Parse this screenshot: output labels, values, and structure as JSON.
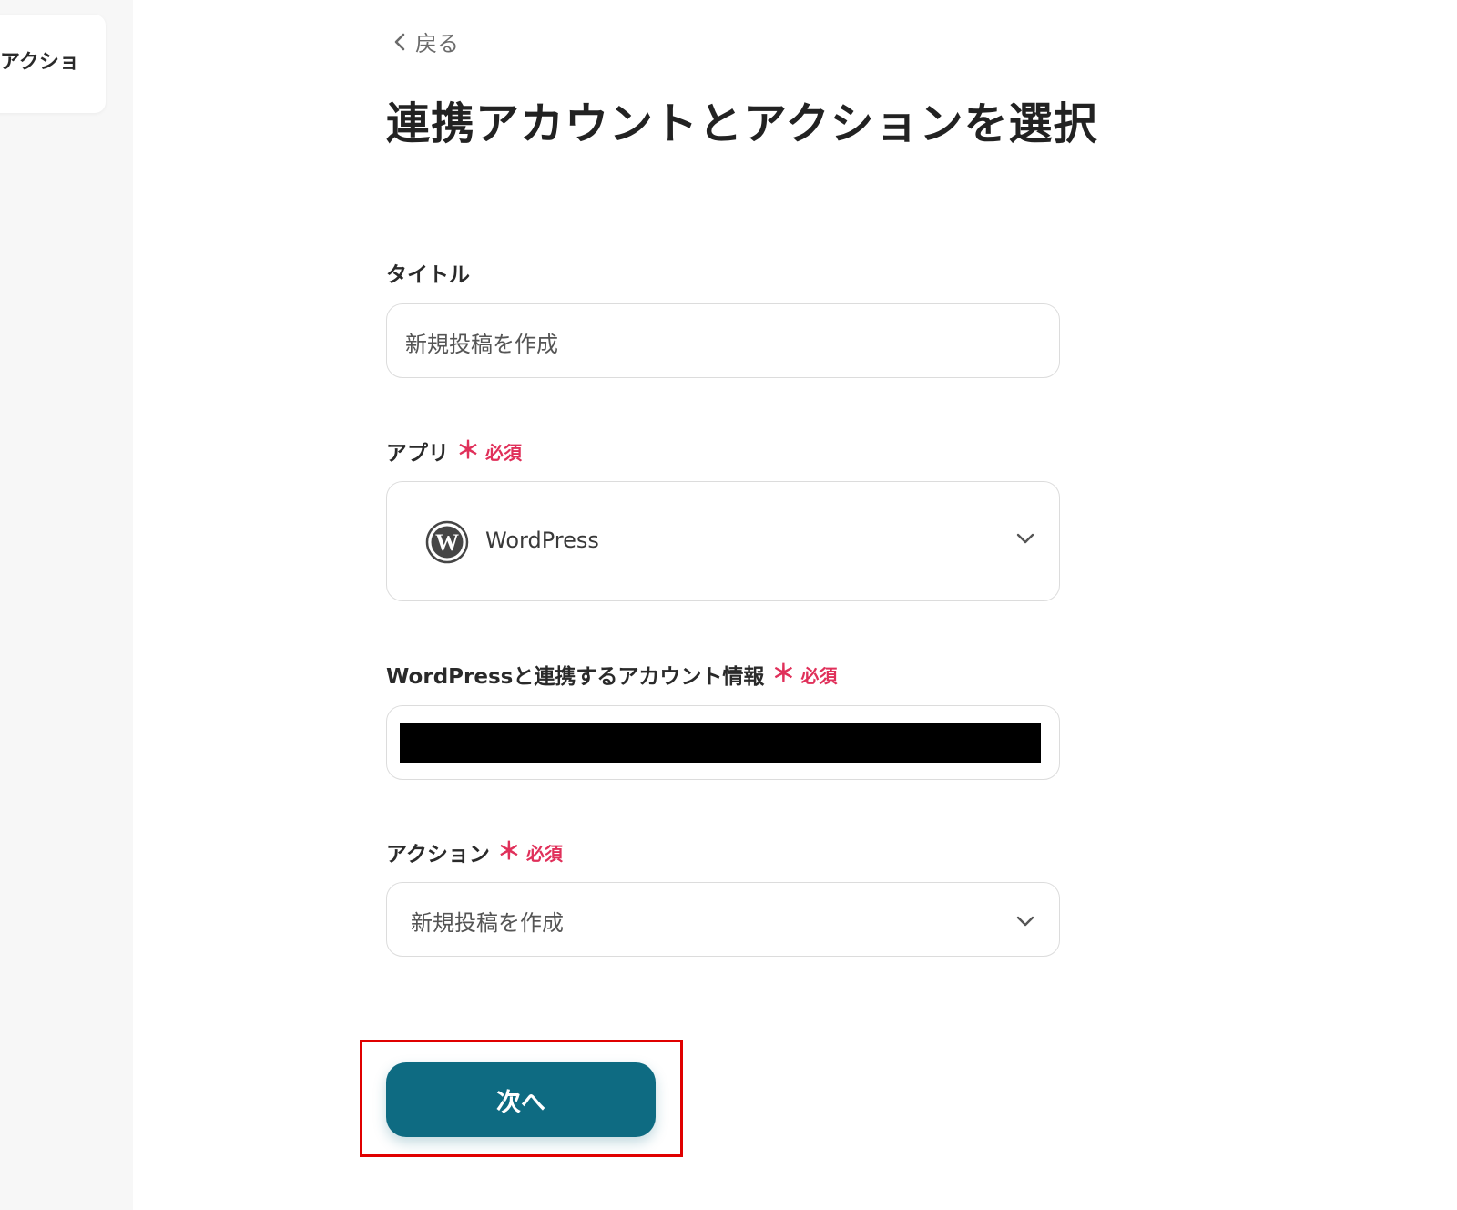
{
  "sidebar": {
    "card_label": "アクショ"
  },
  "header": {
    "back_label": "戻る",
    "title": "連携アカウントとアクションを選択"
  },
  "form": {
    "title_field": {
      "label": "タイトル",
      "value": "新規投稿を作成"
    },
    "app_field": {
      "label": "アプリ",
      "required_star": "＊",
      "required_text": "必須",
      "value": "WordPress",
      "icon": "wordpress-logo-icon"
    },
    "account_field": {
      "label": "WordPressと連携するアカウント情報",
      "required_star": "＊",
      "required_text": "必須"
    },
    "action_field": {
      "label": "アクション",
      "required_star": "＊",
      "required_text": "必須",
      "value": "新規投稿を作成"
    }
  },
  "buttons": {
    "next_label": "次へ"
  },
  "colors": {
    "primary": "#0e6b82",
    "required": "#e0305a",
    "highlight": "#e00000"
  }
}
